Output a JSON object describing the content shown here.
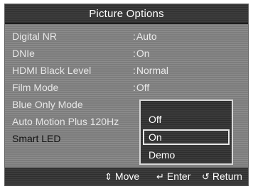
{
  "menu": {
    "title": "Picture Options",
    "items": [
      {
        "label": "Digital NR",
        "value": "Auto"
      },
      {
        "label": "DNIe",
        "value": "On"
      },
      {
        "label": "HDMI Black Level",
        "value": "Normal"
      },
      {
        "label": "Film Mode",
        "value": "Off"
      },
      {
        "label": "Blue Only Mode",
        "value": ""
      },
      {
        "label": "Auto Motion Plus 120Hz",
        "value": ""
      },
      {
        "label": "Smart LED",
        "value": ""
      }
    ]
  },
  "dropdown": {
    "options": [
      "Off",
      "On",
      "Demo"
    ],
    "selected_option": "On"
  },
  "footer": {
    "move_label": "Move",
    "move_icon": "up-down-arrows-icon",
    "enter_label": "Enter",
    "enter_icon": "enter-icon",
    "return_label": "Return",
    "return_icon": "return-icon"
  }
}
